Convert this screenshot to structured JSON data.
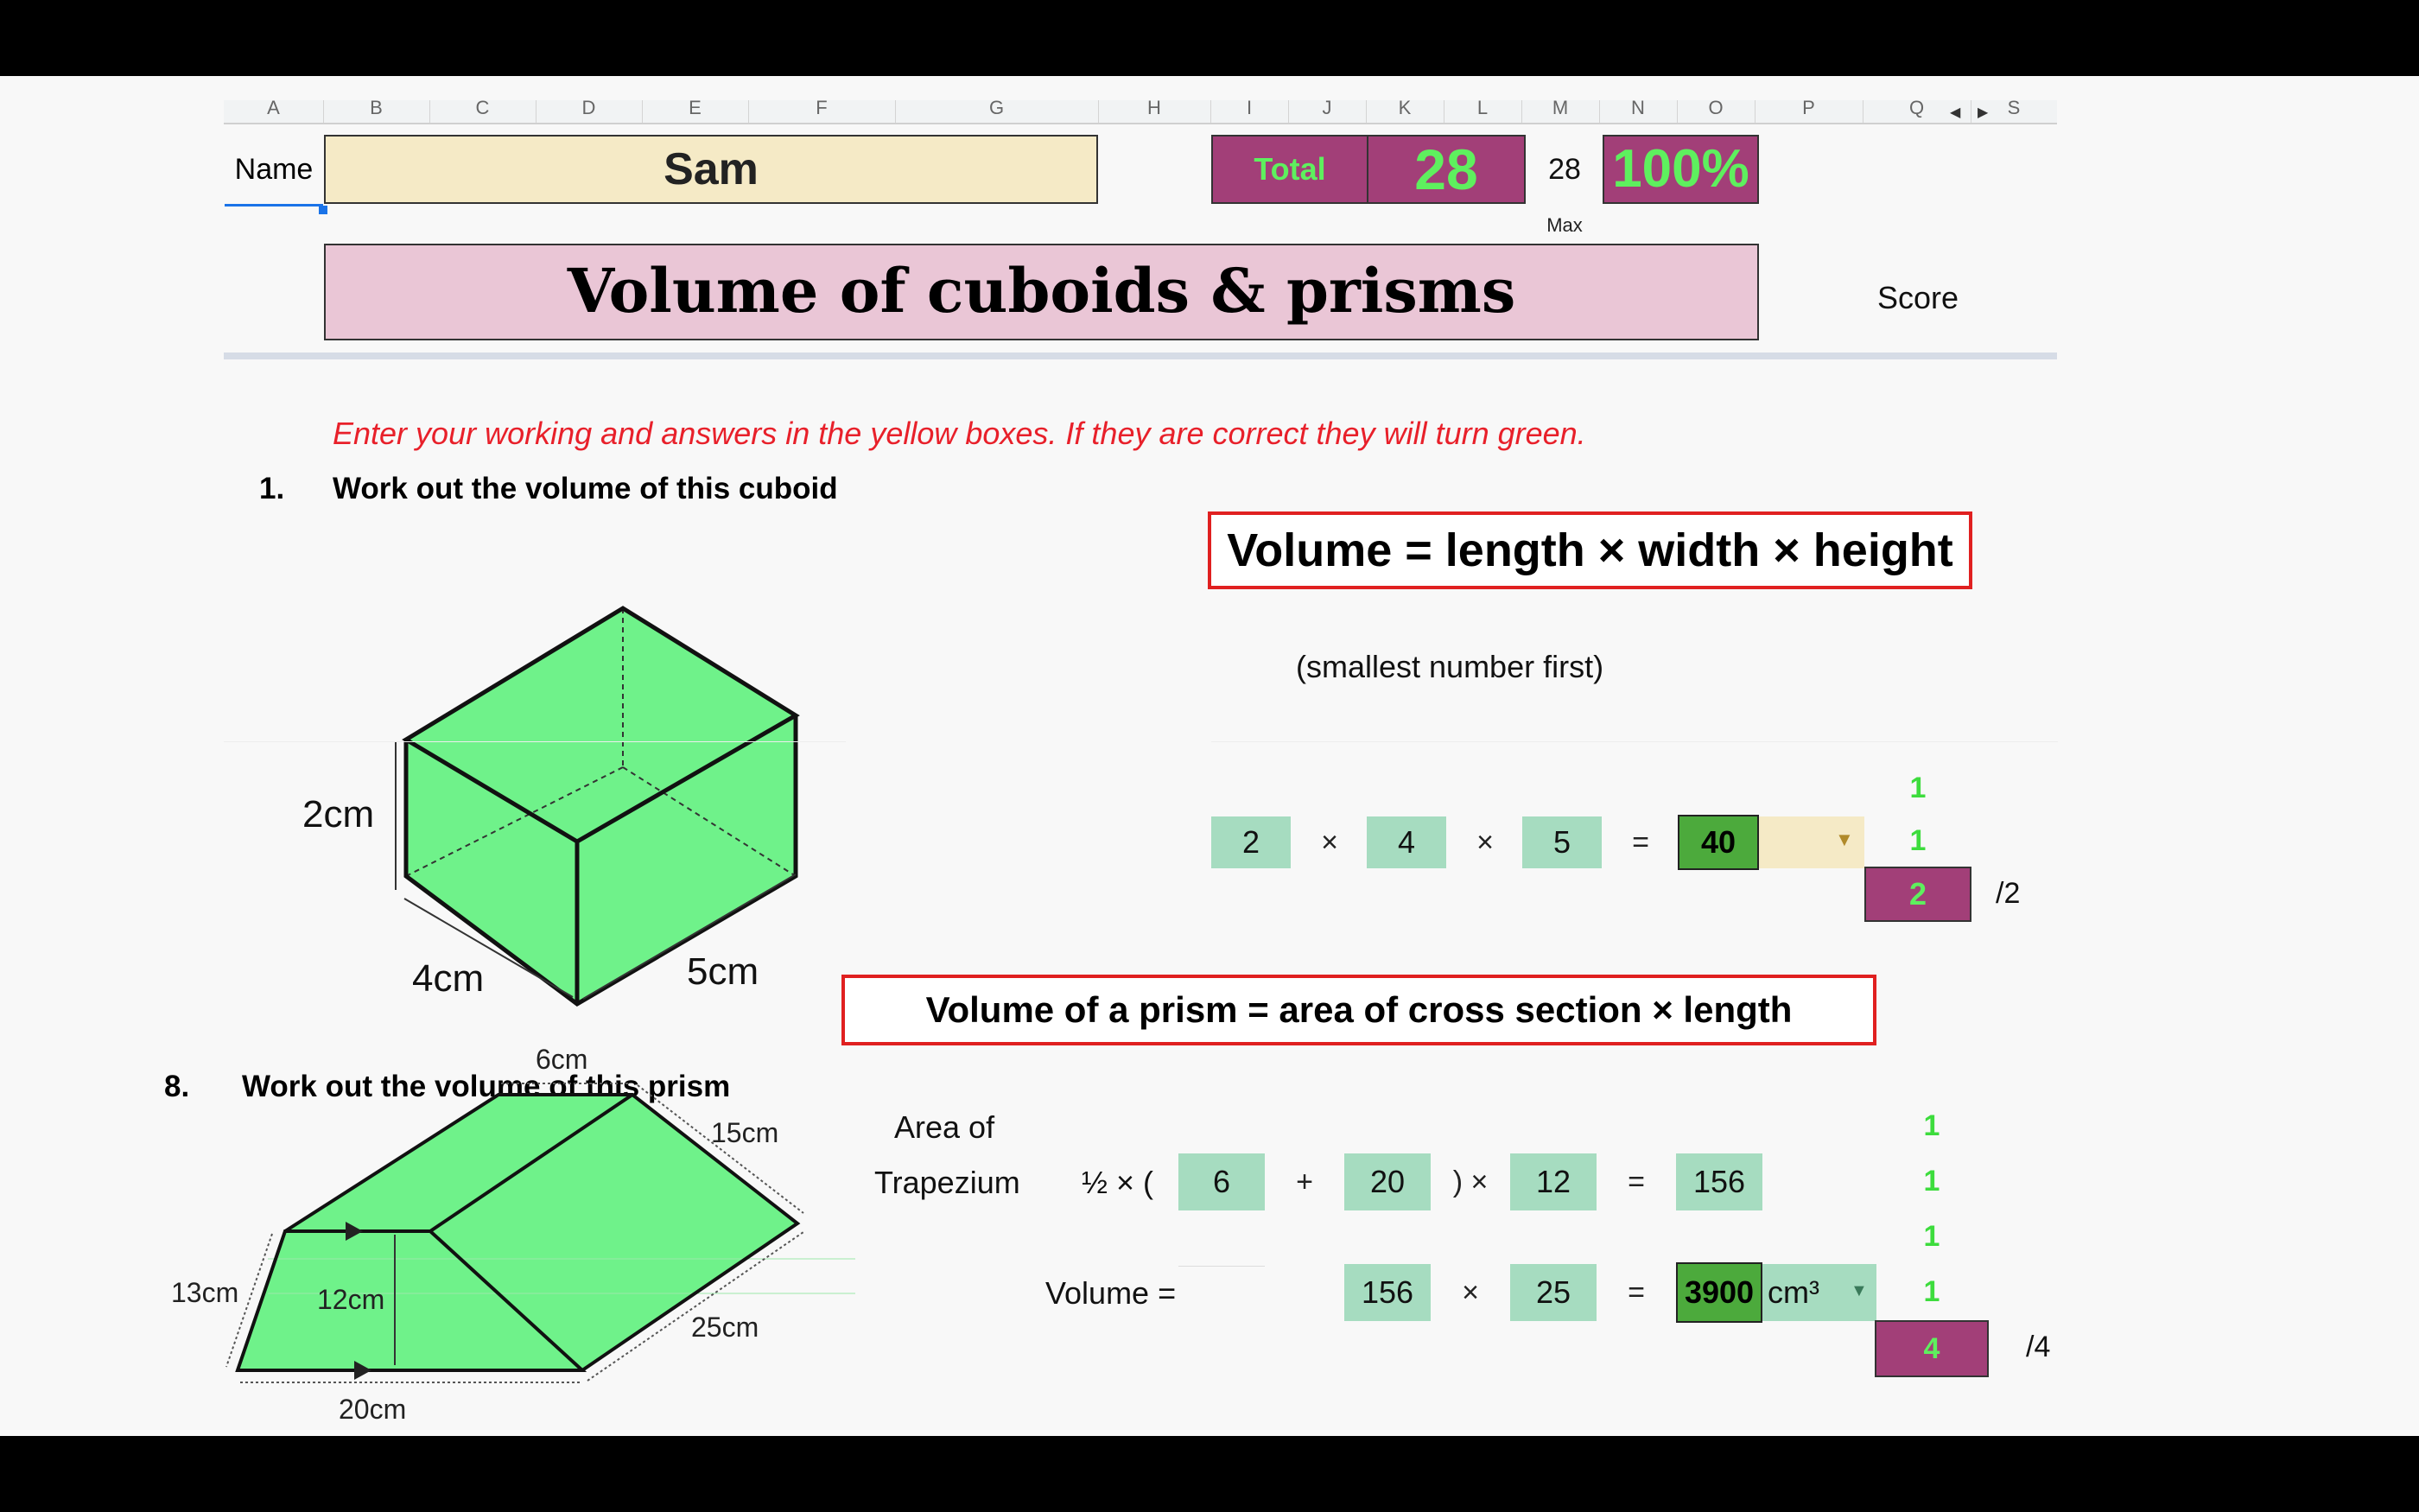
{
  "columns": [
    "A",
    "B",
    "C",
    "D",
    "E",
    "F",
    "G",
    "H",
    "I",
    "J",
    "K",
    "L",
    "M",
    "N",
    "O",
    "P",
    "Q",
    "S"
  ],
  "header": {
    "name_label": "Name",
    "name_value": "Sam",
    "total_label": "Total",
    "total_score": "28",
    "max_value": "28",
    "max_label": "Max",
    "percent": "100%",
    "title": "Volume of cuboids & prisms",
    "score_label": "Score"
  },
  "instructions": "Enter your working and answers in the yellow boxes. If they are correct they will turn green.",
  "q1": {
    "number": "1.",
    "prompt": "Work out the volume of this cuboid",
    "formula": "Volume = length × width × height",
    "hint": "(smallest number first)",
    "dims": {
      "height": "2cm",
      "width": "4cm",
      "length": "5cm"
    },
    "a": "2",
    "op1": "×",
    "b": "4",
    "op2": "×",
    "c": "5",
    "eq": "=",
    "answer": "40",
    "unit_value": "",
    "marks": [
      "1",
      "1"
    ],
    "score": "2",
    "out_of": "/2"
  },
  "q8": {
    "number": "8.",
    "prompt": "Work out the volume of this prism",
    "formula": "Volume of a prism = area of cross section × length",
    "dims": {
      "top": "6cm",
      "depth": "15cm",
      "slant": "13cm",
      "height": "12cm",
      "length": "25cm",
      "bottom": "20cm"
    },
    "area_label_1": "Area of",
    "area_label_2": "Trapezium",
    "half_open": "½ × (",
    "a": "6",
    "plus": "+",
    "b": "20",
    "close_times": ") ×",
    "h": "12",
    "eq": "=",
    "area": "156",
    "volume_label": "Volume =",
    "v_area": "156",
    "times": "×",
    "length": "25",
    "eq2": "=",
    "volume": "3900",
    "unit": "cm³",
    "marks": [
      "1",
      "1",
      "1",
      "1"
    ],
    "score": "4",
    "out_of": "/4"
  },
  "colors": {
    "mark_green": "#3ddc3d",
    "cell_green": "#a6dcc0",
    "dark_green": "#4caa3c",
    "magenta": "#a23f78",
    "yellow": "#f5eac6",
    "title_pink": "#eac6d6",
    "red": "#e02020"
  }
}
